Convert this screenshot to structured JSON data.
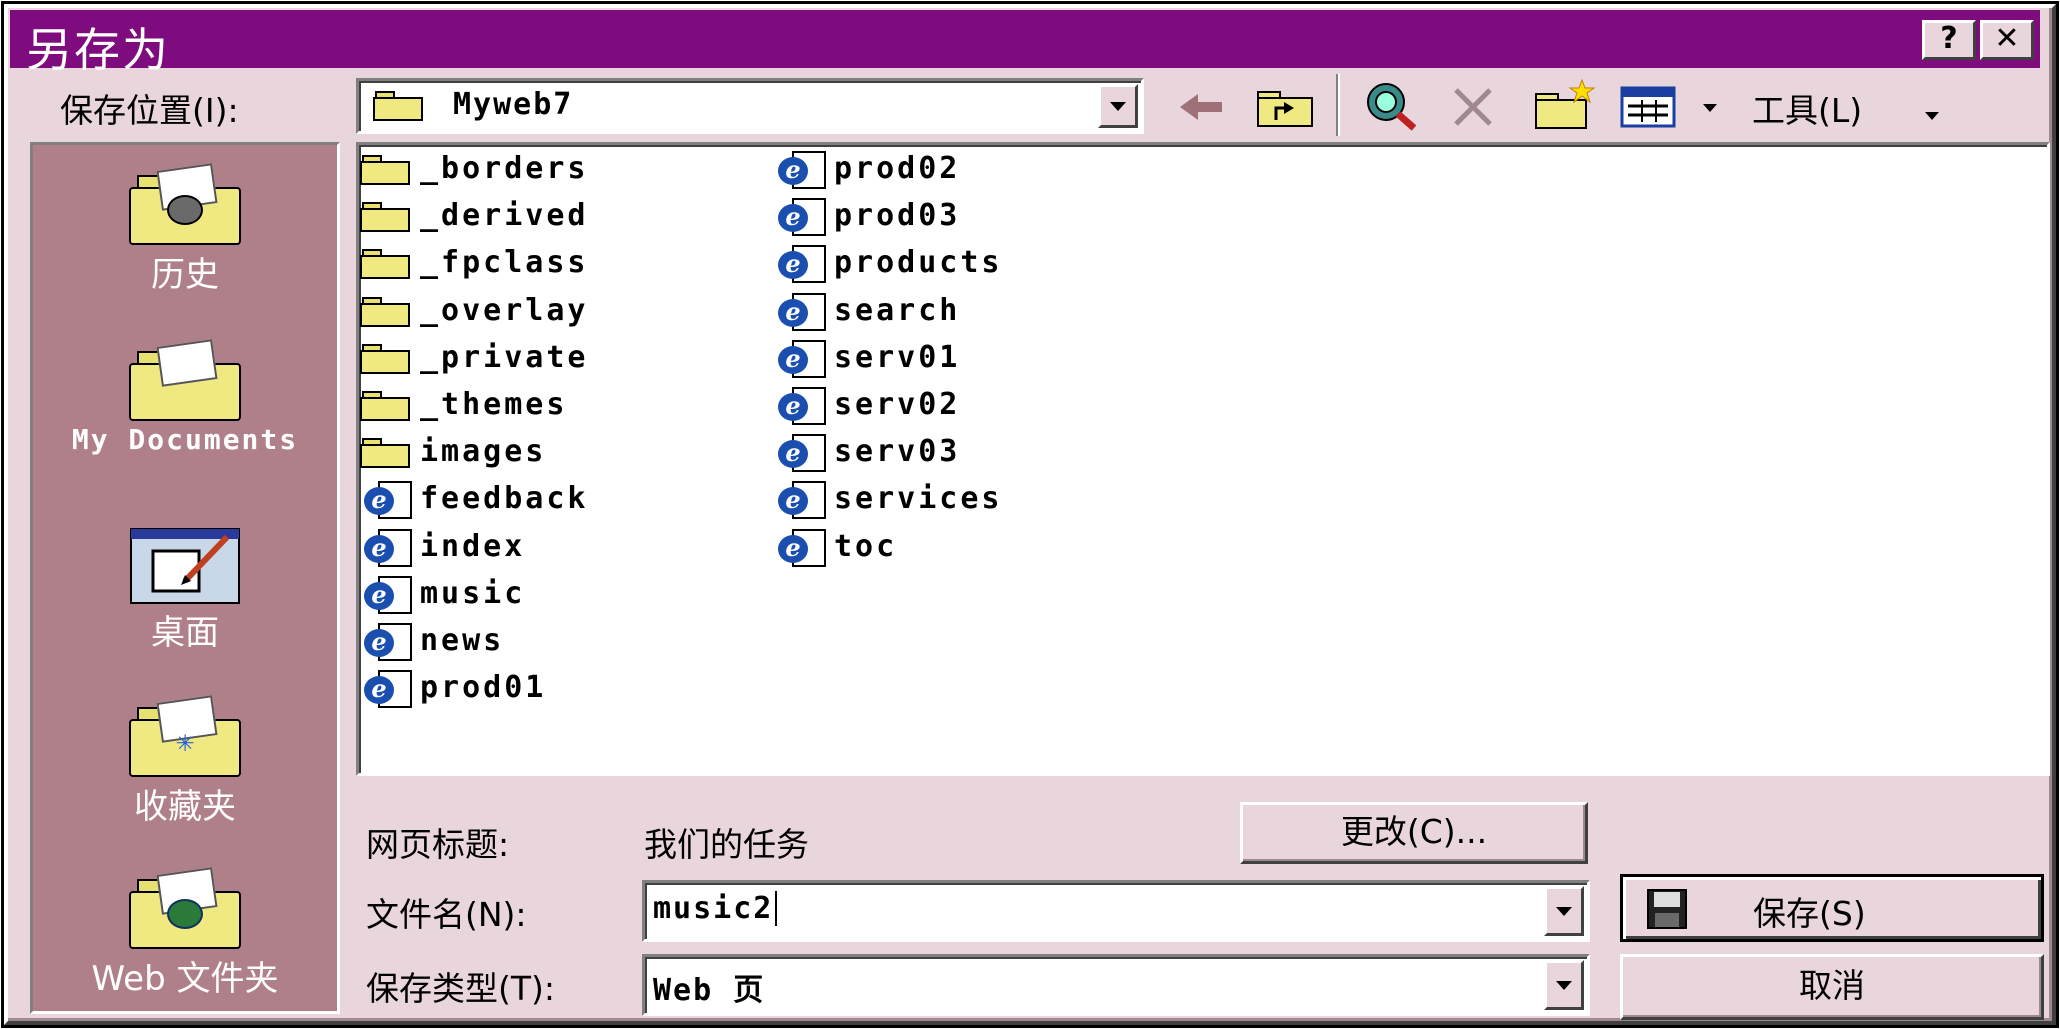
{
  "window": {
    "title": "另存为",
    "help_label": "?",
    "close_label": "✕"
  },
  "location": {
    "label": "保存位置(I):",
    "value": "Myweb7"
  },
  "toolbar": {
    "tools_label": "工具(L)"
  },
  "places": [
    {
      "label": "历史",
      "icon": "history-folder-icon"
    },
    {
      "label": "My Documents",
      "icon": "my-documents-folder-icon"
    },
    {
      "label": "桌面",
      "icon": "desktop-icon"
    },
    {
      "label": "收藏夹",
      "icon": "favorites-folder-icon"
    },
    {
      "label": "Web 文件夹",
      "icon": "web-folders-icon"
    }
  ],
  "files": {
    "column1": [
      {
        "name": "_borders",
        "type": "folder"
      },
      {
        "name": "_derived",
        "type": "folder"
      },
      {
        "name": "_fpclass",
        "type": "folder"
      },
      {
        "name": "_overlay",
        "type": "folder"
      },
      {
        "name": "_private",
        "type": "folder"
      },
      {
        "name": "_themes",
        "type": "folder"
      },
      {
        "name": "images",
        "type": "folder"
      },
      {
        "name": "feedback",
        "type": "html"
      },
      {
        "name": "index",
        "type": "html"
      },
      {
        "name": "music",
        "type": "html"
      },
      {
        "name": "news",
        "type": "html"
      },
      {
        "name": "prod01",
        "type": "html"
      }
    ],
    "column2": [
      {
        "name": "prod02",
        "type": "html"
      },
      {
        "name": "prod03",
        "type": "html"
      },
      {
        "name": "products",
        "type": "html"
      },
      {
        "name": "search",
        "type": "html"
      },
      {
        "name": "serv01",
        "type": "html"
      },
      {
        "name": "serv02",
        "type": "html"
      },
      {
        "name": "serv03",
        "type": "html"
      },
      {
        "name": "services",
        "type": "html"
      },
      {
        "name": "toc",
        "type": "html"
      }
    ]
  },
  "page_title": {
    "label": "网页标题:",
    "value": "我们的任务",
    "change_button": "更改(C)..."
  },
  "filename": {
    "label": "文件名(N):",
    "value": "music2"
  },
  "filetype": {
    "label": "保存类型(T):",
    "value": "Web 页"
  },
  "buttons": {
    "save": "保存(S)",
    "cancel": "取消"
  }
}
